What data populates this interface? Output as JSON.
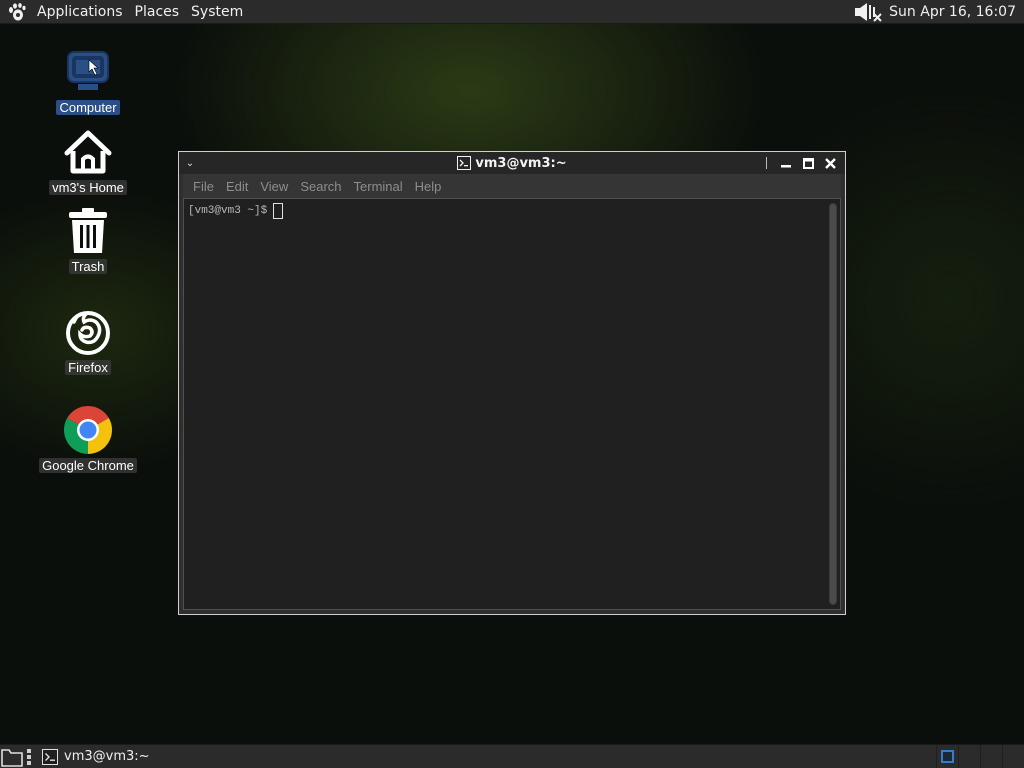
{
  "top_panel": {
    "menu": [
      "Applications",
      "Places",
      "System"
    ],
    "clock": "Sun Apr 16, 16:07",
    "icons": [
      "gnome-foot-icon",
      "volume-muted-icon"
    ]
  },
  "desktop": {
    "icons": [
      {
        "label": "Computer",
        "icon": "computer-icon",
        "selected": true
      },
      {
        "label": "vm3's Home",
        "icon": "home-icon"
      },
      {
        "label": "Trash",
        "icon": "trash-icon"
      },
      {
        "label": "Firefox",
        "icon": "firefox-icon"
      },
      {
        "label": "Google Chrome",
        "icon": "chrome-icon"
      }
    ]
  },
  "terminal": {
    "title": "vm3@vm3:~",
    "menu": [
      "File",
      "Edit",
      "View",
      "Search",
      "Terminal",
      "Help"
    ],
    "prompt": "[vm3@vm3 ~]$"
  },
  "bottom_panel": {
    "task_label": "vm3@vm3:~"
  },
  "colors": {
    "panel": "#2b2b2b",
    "terminal_bg": "#202020",
    "selection": "#2a4f86",
    "workspace_active": "#3a7ac7"
  }
}
